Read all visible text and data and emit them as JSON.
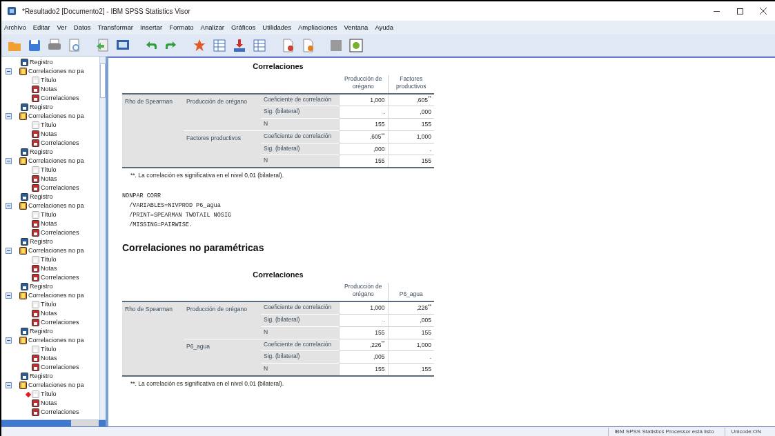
{
  "window": {
    "title": "*Resultado2 [Documento2] - IBM SPSS Statistics Visor"
  },
  "menu": [
    "Archivo",
    "Editar",
    "Ver",
    "Datos",
    "Transformar",
    "Insertar",
    "Formato",
    "Analizar",
    "Gráficos",
    "Utilidades",
    "Ampliaciones",
    "Ventana",
    "Ayuda"
  ],
  "outline": [
    {
      "kind": "log",
      "label": "Registro"
    },
    {
      "kind": "group",
      "label": "Correlaciones no pa",
      "expanded": true,
      "children": [
        {
          "kind": "title",
          "label": "Título",
          "current": false
        },
        {
          "kind": "notes",
          "label": "Notas",
          "current": false
        },
        {
          "kind": "table",
          "label": "Correlaciones",
          "current": false
        }
      ]
    },
    {
      "kind": "log",
      "label": "Registro"
    },
    {
      "kind": "group",
      "label": "Correlaciones no pa",
      "expanded": true,
      "children": [
        {
          "kind": "title",
          "label": "Título",
          "current": false
        },
        {
          "kind": "notes",
          "label": "Notas",
          "current": false
        },
        {
          "kind": "table",
          "label": "Correlaciones",
          "current": false
        }
      ]
    },
    {
      "kind": "log",
      "label": "Registro"
    },
    {
      "kind": "group",
      "label": "Correlaciones no pa",
      "expanded": true,
      "children": [
        {
          "kind": "title",
          "label": "Título",
          "current": false
        },
        {
          "kind": "notes",
          "label": "Notas",
          "current": false
        },
        {
          "kind": "table",
          "label": "Correlaciones",
          "current": false
        }
      ]
    },
    {
      "kind": "log",
      "label": "Registro"
    },
    {
      "kind": "group",
      "label": "Correlaciones no pa",
      "expanded": true,
      "children": [
        {
          "kind": "title",
          "label": "Título",
          "current": false
        },
        {
          "kind": "notes",
          "label": "Notas",
          "current": false
        },
        {
          "kind": "table",
          "label": "Correlaciones",
          "current": false
        }
      ]
    },
    {
      "kind": "log",
      "label": "Registro"
    },
    {
      "kind": "group",
      "label": "Correlaciones no pa",
      "expanded": true,
      "children": [
        {
          "kind": "title",
          "label": "Título",
          "current": false
        },
        {
          "kind": "notes",
          "label": "Notas",
          "current": false
        },
        {
          "kind": "table",
          "label": "Correlaciones",
          "current": false
        }
      ]
    },
    {
      "kind": "log",
      "label": "Registro"
    },
    {
      "kind": "group",
      "label": "Correlaciones no pa",
      "expanded": true,
      "children": [
        {
          "kind": "title",
          "label": "Título",
          "current": false
        },
        {
          "kind": "notes",
          "label": "Notas",
          "current": false
        },
        {
          "kind": "table",
          "label": "Correlaciones",
          "current": false
        }
      ]
    },
    {
      "kind": "log",
      "label": "Registro"
    },
    {
      "kind": "group",
      "label": "Correlaciones no pa",
      "expanded": true,
      "children": [
        {
          "kind": "title",
          "label": "Título",
          "current": false
        },
        {
          "kind": "notes",
          "label": "Notas",
          "current": false
        },
        {
          "kind": "table",
          "label": "Correlaciones",
          "current": false
        }
      ]
    },
    {
      "kind": "log",
      "label": "Registro"
    },
    {
      "kind": "group",
      "label": "Correlaciones no pa",
      "expanded": true,
      "children": [
        {
          "kind": "title",
          "label": "Título",
          "current": true
        },
        {
          "kind": "notes",
          "label": "Notas",
          "current": false
        },
        {
          "kind": "table",
          "label": "Correlaciones",
          "current": false
        }
      ]
    }
  ],
  "output": [
    {
      "kind": "table",
      "title": "Correlaciones",
      "columns": [
        "Producción de orégano",
        "Factores productivos"
      ],
      "row_group": "Rho de Spearman",
      "variables": [
        {
          "name": "Producción de orégano",
          "stats": [
            {
              "label": "Coeficiente de correlación",
              "values": [
                "1,000",
                ",605$^{**}$"
              ]
            },
            {
              "label": "Sig. (bilateral)",
              "values": [
                ".",
                ",000"
              ]
            },
            {
              "label": "N",
              "values": [
                "155",
                "155"
              ]
            }
          ]
        },
        {
          "name": "Factores productivos",
          "stats": [
            {
              "label": "Coeficiente de correlación",
              "values": [
                ",605$^{**}$",
                "1,000"
              ]
            },
            {
              "label": "Sig. (bilateral)",
              "values": [
                ",000",
                "."
              ]
            },
            {
              "label": "N",
              "values": [
                "155",
                "155"
              ]
            }
          ]
        }
      ],
      "footnote": "**. La correlación es significativa en el nivel 0,01 (bilateral)."
    },
    {
      "kind": "syntax",
      "lines": [
        "NONPAR CORR",
        "  /VARIABLES=NIVPROD P6_agua",
        "  /PRINT=SPEARMAN TWOTAIL NOSIG",
        "  /MISSING=PAIRWISE."
      ]
    },
    {
      "kind": "heading",
      "text": "Correlaciones no paramétricas"
    },
    {
      "kind": "table",
      "title": "Correlaciones",
      "columns": [
        "Producción de orégano",
        "P6_agua"
      ],
      "row_group": "Rho de Spearman",
      "variables": [
        {
          "name": "Producción de orégano",
          "stats": [
            {
              "label": "Coeficiente de correlación",
              "values": [
                "1,000",
                ",226$^{**}$"
              ]
            },
            {
              "label": "Sig. (bilateral)",
              "values": [
                ".",
                ",005"
              ]
            },
            {
              "label": "N",
              "values": [
                "155",
                "155"
              ]
            }
          ]
        },
        {
          "name": "P6_agua",
          "stats": [
            {
              "label": "Coeficiente de correlación",
              "values": [
                ",226$^{**}$",
                "1,000"
              ]
            },
            {
              "label": "Sig. (bilateral)",
              "values": [
                ",005",
                "."
              ]
            },
            {
              "label": "N",
              "values": [
                "155",
                "155"
              ]
            }
          ]
        }
      ],
      "footnote": "**. La correlación es significativa en el nivel 0,01 (bilateral)."
    }
  ],
  "status_bar": [
    "IBM SPSS Statistics Processor está listo",
    "Unicode:ON"
  ]
}
